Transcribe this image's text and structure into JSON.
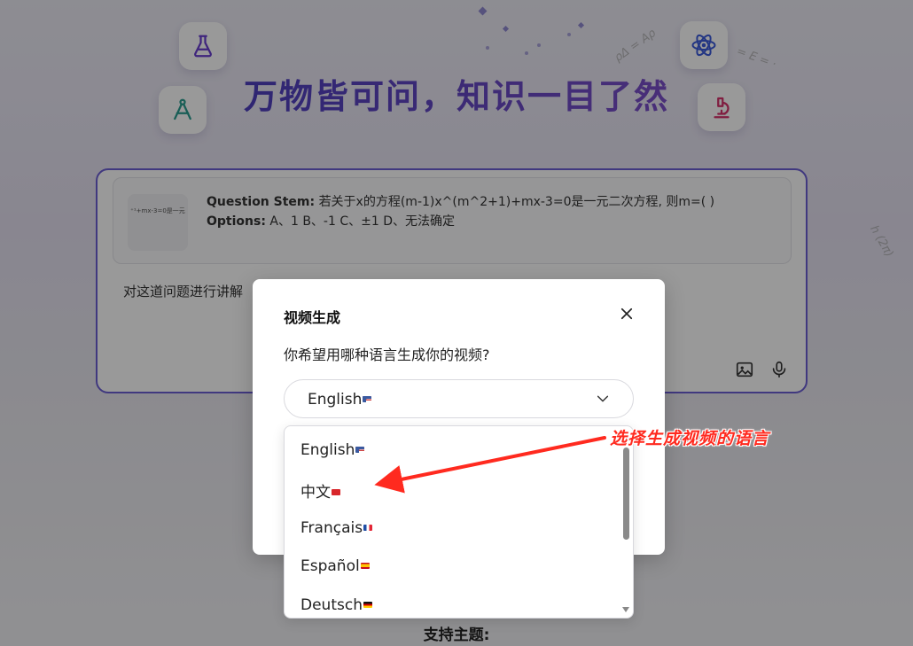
{
  "hero": {
    "title": "万物皆可问，知识一目了然"
  },
  "question_card": {
    "thumb_text": "⁺¹+mx-3=0是一元",
    "stem_label": "Question Stem:",
    "stem_text": "若关于x的方程(m-1)x^(m^2+1)+mx-3=0是一元二次方程, 则m=( )",
    "options_label": "Options:",
    "options_text": "A、1 B、-1 C、±1 D、无法确定",
    "prompt": "对这道问题进行讲解"
  },
  "support_title": "支持主题:",
  "modal": {
    "title": "视频生成",
    "question": "你希望用哪种语言生成你的视频?",
    "selected_language": "English"
  },
  "language_options": [
    {
      "label": "English",
      "flag": "us"
    },
    {
      "label": "中文",
      "flag": "cn"
    },
    {
      "label": "Français",
      "flag": "fr"
    },
    {
      "label": "Español",
      "flag": "es"
    },
    {
      "label": "Deutsch",
      "flag": "de"
    }
  ],
  "annotation": {
    "text": "选择生成视频的语言",
    "color": "#ff2a1f"
  },
  "colors": {
    "accent": "#6c5ed4",
    "title_purple": "#5b47c4"
  },
  "icons": [
    "flask-icon",
    "compass-icon",
    "atom-icon",
    "microscope-icon",
    "image-upload-icon",
    "microphone-icon",
    "close-icon",
    "chevron-down-icon"
  ]
}
